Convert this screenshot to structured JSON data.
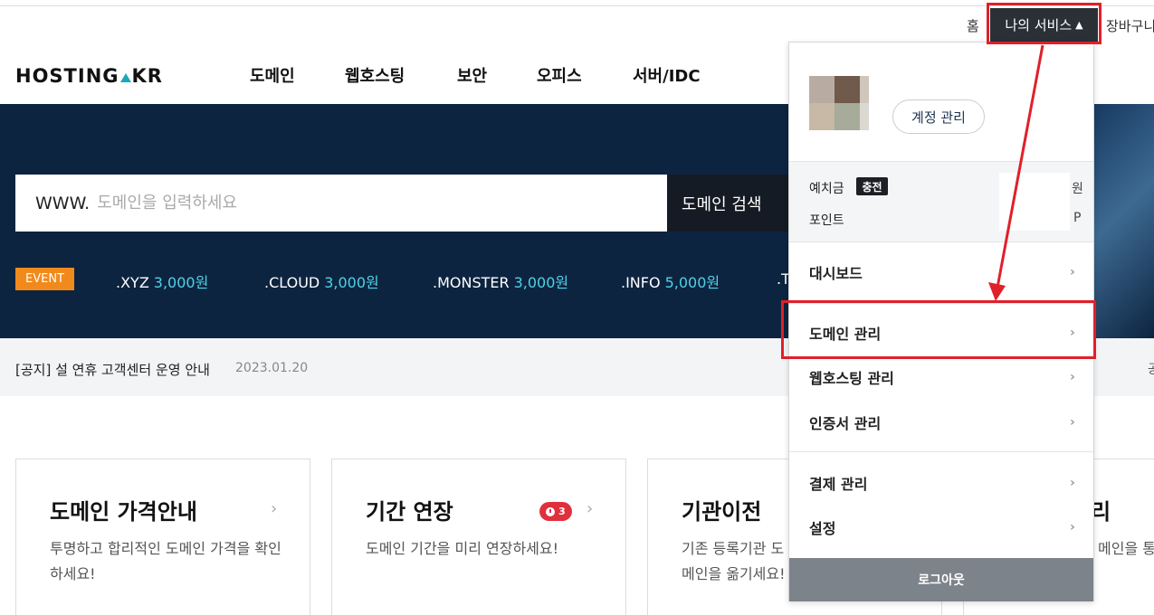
{
  "util": {
    "home": "홈",
    "my_service": "나의 서비스",
    "caret": "▲",
    "cart": "장바구니"
  },
  "logo": {
    "text_left": "HOSTING",
    "text_right": "KR"
  },
  "nav": [
    "도메인",
    "웹호스팅",
    "보안",
    "오피스",
    "서버/IDC"
  ],
  "search": {
    "prefix": "WWW.",
    "placeholder": "도메인을 입력하세요",
    "button": "도메인 검색"
  },
  "event_badge": "EVENT",
  "promos": [
    {
      "name": ".XYZ",
      "price": "3,000원"
    },
    {
      "name": ".CLOUD",
      "price": "3,000원"
    },
    {
      "name": ".MONSTER",
      "price": "3,000원"
    },
    {
      "name": ".INFO",
      "price": "5,000원"
    },
    {
      "name": ".T",
      "price": ""
    }
  ],
  "notice": {
    "text": "[공지] 설 연휴 고객센터 운영 안내",
    "date": "2023.01.20",
    "edge": "공"
  },
  "cards": [
    {
      "title": "도메인 가격안내",
      "desc": "투명하고 합리적인 도메인 가격을 확인하세요!"
    },
    {
      "title": "기간 연장",
      "desc": "도메인 기간을 미리 연장하세요!",
      "badge": "3"
    },
    {
      "title": "기관이전",
      "desc": "기존 등록기관 도메인을 옮기세요!"
    },
    {
      "title": "리",
      "desc": "메인을 통"
    }
  ],
  "dropdown": {
    "account_button": "계정 관리",
    "deposit_label": "예치금",
    "charge_badge": "충전",
    "deposit_unit": "원",
    "point_label": "포인트",
    "point_unit": "P",
    "menu": [
      {
        "label": "대시보드"
      },
      {
        "label": "도메인 관리"
      },
      {
        "label": "웹호스팅 관리"
      },
      {
        "label": "인증서 관리"
      },
      {
        "label": "결제 관리"
      },
      {
        "label": "설정"
      }
    ],
    "chevron": "›",
    "logout": "로그아웃"
  },
  "colors": {
    "hero_bg": "#0d2440",
    "accent_cyan": "#4fd2e6",
    "event_orange": "#f08a1c",
    "highlight_red": "#e0202a"
  }
}
